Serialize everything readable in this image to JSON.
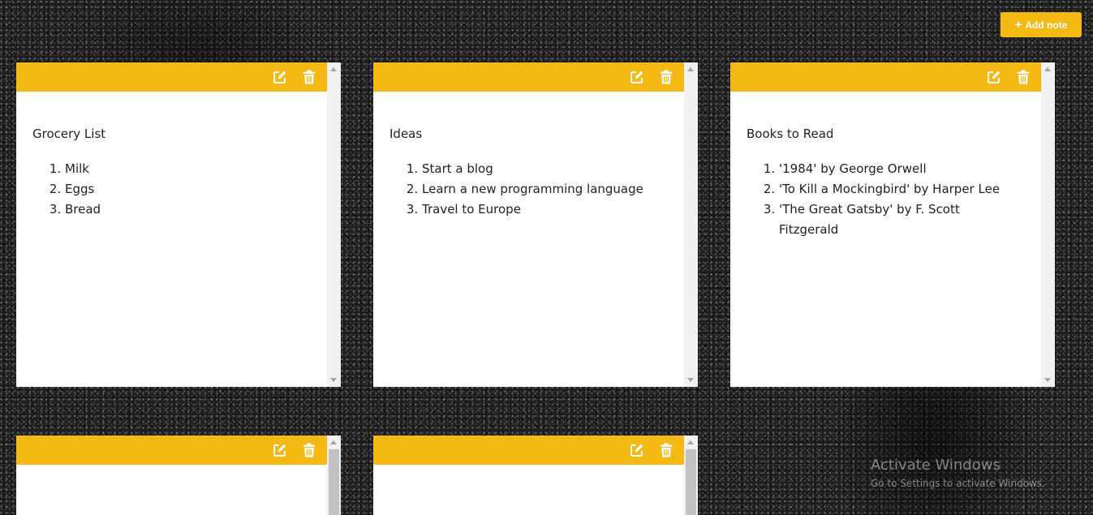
{
  "toolbar": {
    "add_note_label": "Add note",
    "add_note_icon": "plus-icon",
    "accent_color": "#f5b914"
  },
  "notes": [
    {
      "title": "Grocery List",
      "items": [
        "Milk",
        "Eggs",
        "Bread"
      ],
      "edit_icon": "edit-icon",
      "delete_icon": "trash-icon"
    },
    {
      "title": "Ideas",
      "items": [
        "Start a blog",
        "Learn a new programming language",
        "Travel to Europe"
      ],
      "edit_icon": "edit-icon",
      "delete_icon": "trash-icon"
    },
    {
      "title": "Books to Read",
      "items": [
        "'1984' by George Orwell",
        "'To Kill a Mockingbird' by Harper Lee",
        "'The Great Gatsby' by F. Scott Fitzgerald"
      ],
      "edit_icon": "edit-icon",
      "delete_icon": "trash-icon"
    },
    {
      "title": "",
      "items": [],
      "edit_icon": "edit-icon",
      "delete_icon": "trash-icon"
    },
    {
      "title": "",
      "items": [],
      "edit_icon": "edit-icon",
      "delete_icon": "trash-icon"
    }
  ],
  "watermark": {
    "title": "Activate Windows",
    "subtitle": "Go to Settings to activate Windows."
  }
}
